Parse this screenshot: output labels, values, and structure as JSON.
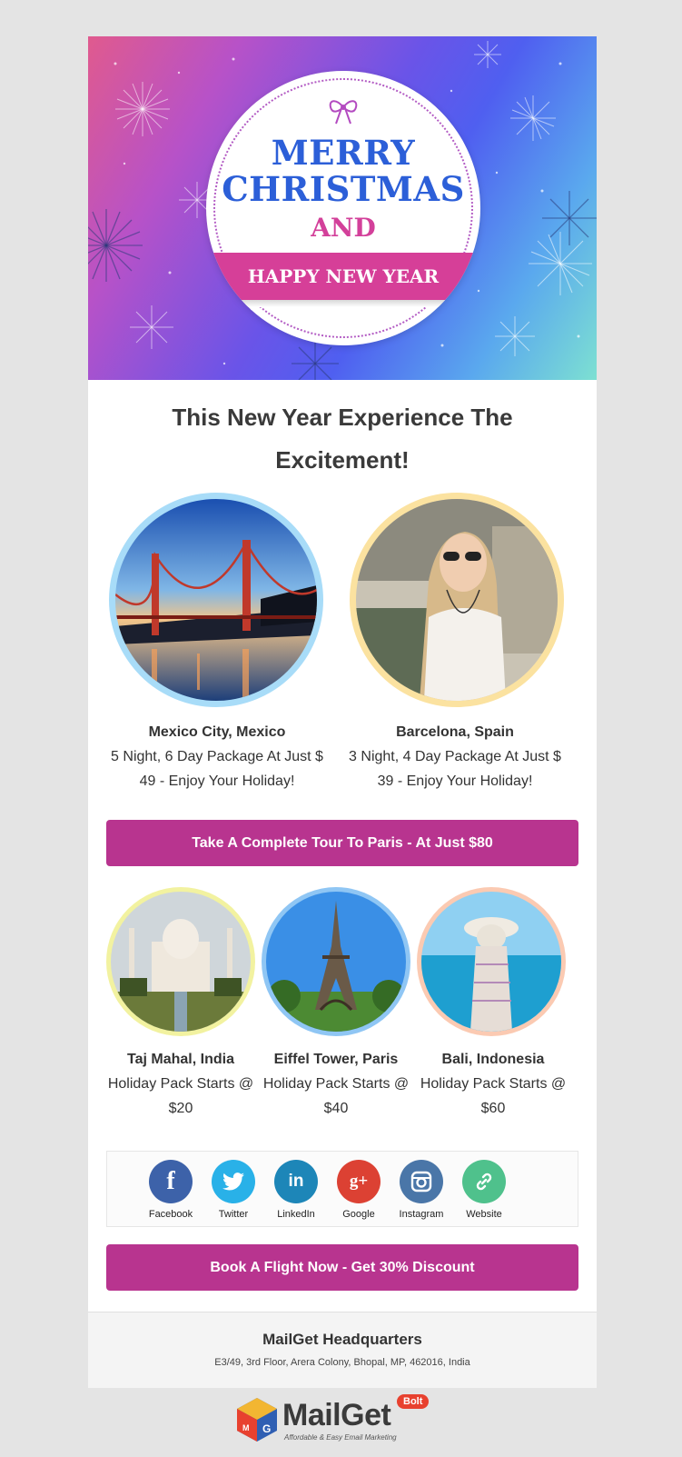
{
  "hero": {
    "line1": "MERRY",
    "line2": "CHRISTMAS",
    "line3": "AND",
    "ribbon": "HAPPY NEW YEAR"
  },
  "headline": "This New Year Experience The Excitement!",
  "featured": [
    {
      "title": "Mexico City, Mexico",
      "desc": "5 Night, 6 Day Package At Just $ 49 - Enjoy Your Holiday!",
      "ring": "#a8dcf8"
    },
    {
      "title": "Barcelona, Spain",
      "desc": "3 Night, 4 Day Package At Just $ 39 - Enjoy Your Holiday!",
      "ring": "#fbe2a0"
    }
  ],
  "cta1": "Take A Complete Tour To Paris - At Just $80",
  "destinations": [
    {
      "title": "Taj Mahal, India",
      "desc": "Holiday Pack Starts @ $20",
      "ring": "#f2f2a0"
    },
    {
      "title": "Eiffel Tower, Paris",
      "desc": "Holiday Pack Starts @ $40",
      "ring": "#8fc6f4"
    },
    {
      "title": "Bali, Indonesia",
      "desc": "Holiday Pack Starts @ $60",
      "ring": "#fbcab2"
    }
  ],
  "social": [
    {
      "label": "Facebook",
      "icon": "facebook-icon",
      "color": "#3d62a9",
      "glyph": "f"
    },
    {
      "label": "Twitter",
      "icon": "twitter-icon",
      "color": "#29b1e8",
      "glyph": "🐦"
    },
    {
      "label": "LinkedIn",
      "icon": "linkedin-icon",
      "color": "#1d86b8",
      "glyph": "in"
    },
    {
      "label": "Google",
      "icon": "google-plus-icon",
      "color": "#dc4133",
      "glyph": "g+"
    },
    {
      "label": "Instagram",
      "icon": "instagram-icon",
      "color": "#4a76a8",
      "glyph": "◎"
    },
    {
      "label": "Website",
      "icon": "link-icon",
      "color": "#4fc18c",
      "glyph": "🔗"
    }
  ],
  "cta2": "Book A Flight Now - Get 30% Discount",
  "footer": {
    "name": "MailGet Headquarters",
    "address": "E3/49, 3rd Floor, Arera Colony, Bhopal, MP, 462016, India"
  },
  "brand": {
    "name": "MailGet",
    "badge": "Bolt",
    "tagline": "Affordable & Easy Email Marketing"
  },
  "colors": {
    "accent": "#b8348f",
    "title_blue": "#2c5fd8",
    "pink": "#d63f98"
  }
}
